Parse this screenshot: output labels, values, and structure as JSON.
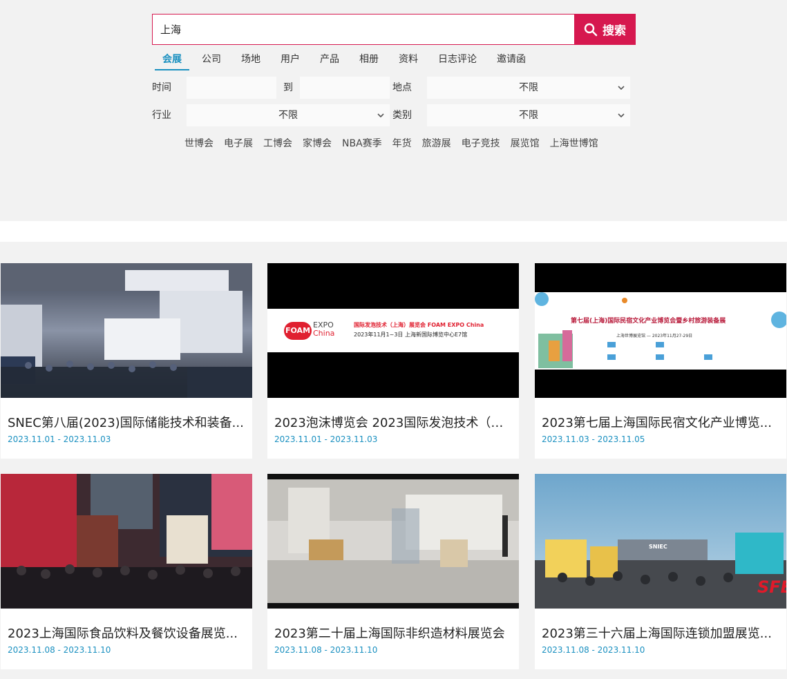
{
  "search": {
    "value": "上海",
    "button_label": "搜索"
  },
  "tabs": [
    {
      "label": "会展",
      "active": true
    },
    {
      "label": "公司"
    },
    {
      "label": "场地"
    },
    {
      "label": "用户"
    },
    {
      "label": "产品"
    },
    {
      "label": "相册"
    },
    {
      "label": "资料"
    },
    {
      "label": "日志评论"
    },
    {
      "label": "邀请函"
    }
  ],
  "filters": {
    "time_label": "时间",
    "to_label": "到",
    "location_label": "地点",
    "location_value": "不限",
    "industry_label": "行业",
    "industry_value": "不限",
    "category_label": "类别",
    "category_value": "不限"
  },
  "quick_tags": [
    "世博会",
    "电子展",
    "工博会",
    "家博会",
    "NBA赛季",
    "年货",
    "旅游展",
    "电子竞技",
    "展览馆",
    "上海世博馆"
  ],
  "cards": [
    {
      "title": "SNEC第八届(2023)国际储能技术和装备...",
      "date": "2023.11.01 - 2023.11.03"
    },
    {
      "title": "2023泡沫博览会 2023国际发泡技术（上...",
      "date": "2023.11.01 - 2023.11.03",
      "banner_logo_1": "FOAM",
      "banner_logo_2": "EXPO",
      "banner_logo_3": "China",
      "banner_line_1": "国际发泡技术（上海）展览会 FOAM EXPO China",
      "banner_line_2": "2023年11月1~3日 上海新国际博览中心E7馆"
    },
    {
      "title": "2023第七届上海国际民宿文化产业博览...",
      "date": "2023.11.03 - 2023.11.05",
      "banner_heading": "第七届(上海)国际民宿文化产业博览会暨乡村旅游装备展",
      "banner_sub": "上海世博展览馆 — 2023年11月27-29日"
    },
    {
      "title": "2023上海国际食品饮料及餐饮设备展览...",
      "date": "2023.11.08 - 2023.11.10"
    },
    {
      "title": "2023第二十届上海国际非织造材料展览会",
      "date": "2023.11.08 - 2023.11.10"
    },
    {
      "title": "2023第三十六届上海国际连锁加盟展览...",
      "date": "2023.11.08 - 2023.11.10",
      "photo_sign": "SNIEC",
      "photo_mark": "SFE"
    }
  ],
  "colors": {
    "accent": "#d6184f",
    "link": "#1a90c0"
  }
}
